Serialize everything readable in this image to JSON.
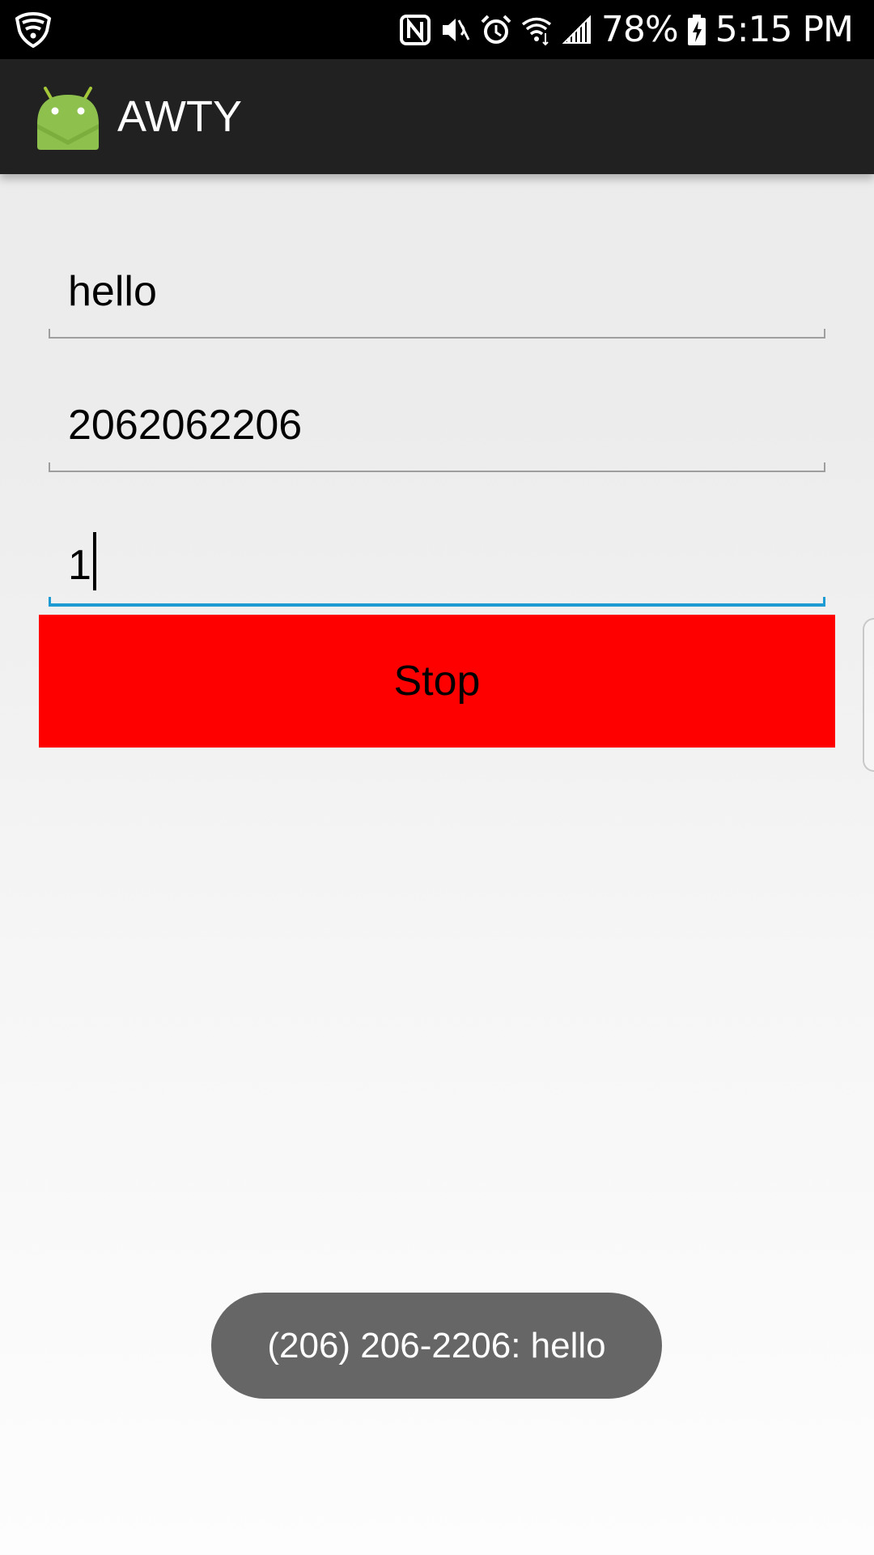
{
  "status_bar": {
    "battery_percent": "78%",
    "time": "5:15 PM",
    "icons": [
      "security-shield-icon",
      "nfc-icon",
      "mute-icon",
      "alarm-icon",
      "wifi-icon",
      "signal-icon",
      "battery-charging-icon"
    ]
  },
  "app_bar": {
    "title": "AWTY",
    "logo_icon": "android-icon",
    "background": "#212121"
  },
  "form": {
    "message_value": "hello",
    "phone_value": "2062062206",
    "interval_value": "1",
    "focused_field": "interval",
    "focus_color": "#1e9bd2"
  },
  "stop_button": {
    "label": "Stop",
    "color": "#ff0000"
  },
  "toast": {
    "text": "(206) 206-2206: hello"
  }
}
